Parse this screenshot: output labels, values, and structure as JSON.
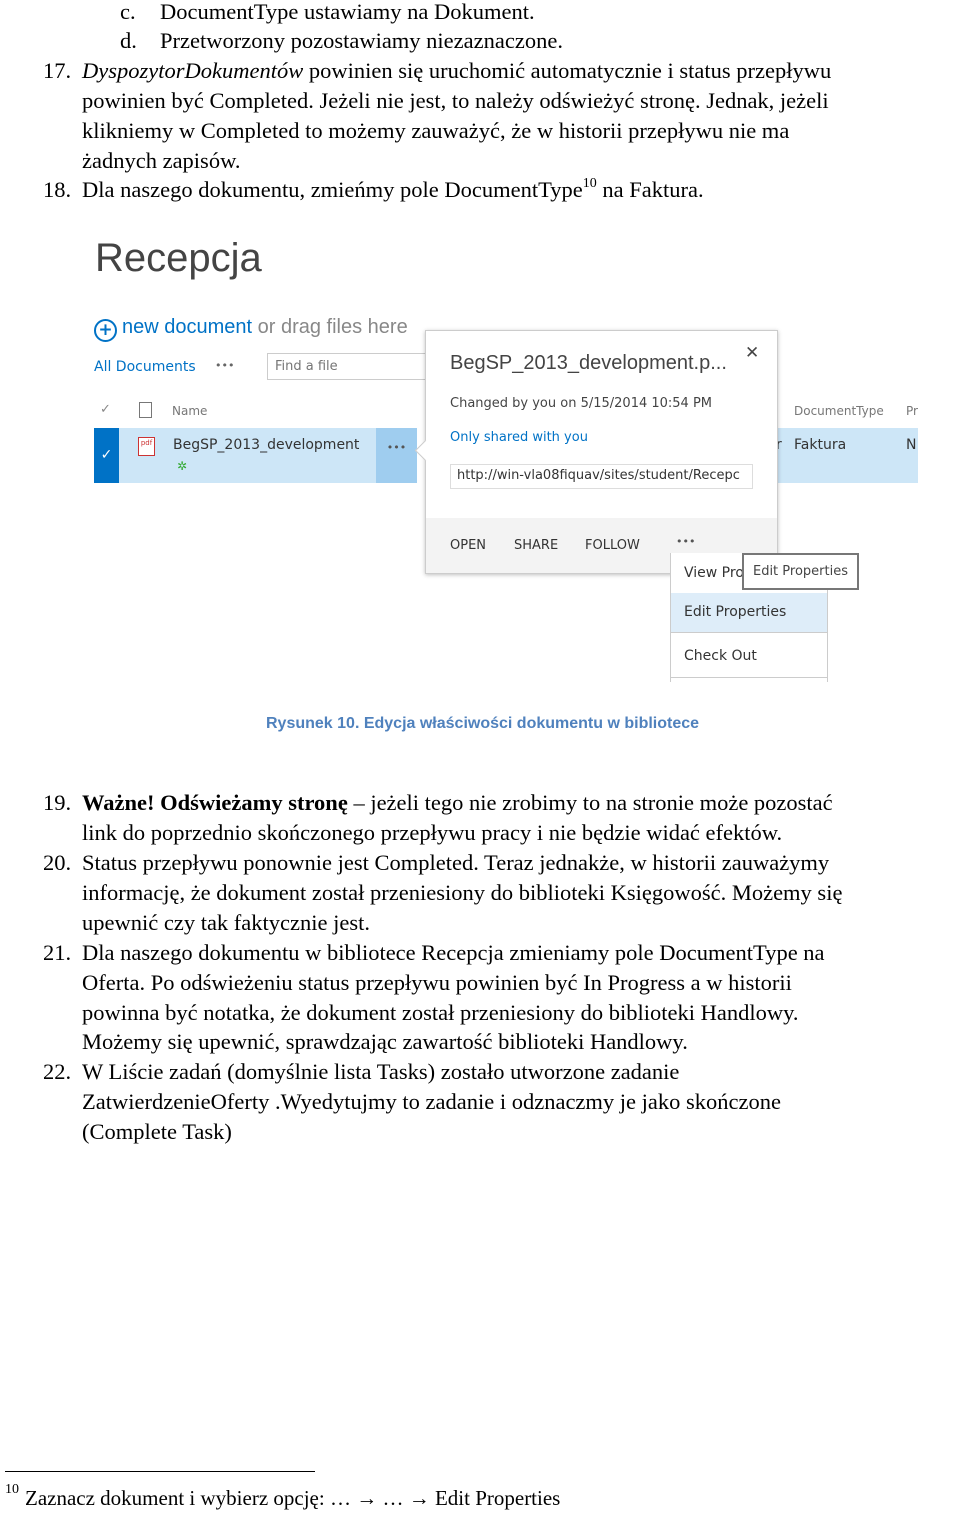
{
  "intro": {
    "items": [
      {
        "marker": "c.",
        "lines": [
          "DocumentType ustawiamy na Dokument."
        ]
      },
      {
        "marker": "d.",
        "lines": [
          "Przetworzony pozostawiamy niezaznaczone."
        ]
      }
    ]
  },
  "item17": {
    "marker": "17.",
    "italic": "DyspozytorDokumentów",
    "lines": [
      " powinien się uruchomić automatycznie i status przepływu",
      "powinien być Completed. Jeżeli nie jest, to należy odświeżyć stronę. Jednak, jeżeli",
      "klikniemy w Completed to możemy zauważyć, że w historii przepływu nie ma",
      "żadnych zapisów."
    ]
  },
  "item18": {
    "marker": "18.",
    "text_before": "Dla naszego dokumentu, zmieńmy pole DocumentType",
    "footnote_ref": "10",
    "text_after": " na Faktura."
  },
  "screenshot": {
    "library_title": "Recepcja",
    "new_document": "new document",
    "drag_text": " or drag files here",
    "view_name": "All Documents",
    "view_more": "•••",
    "search_placeholder": "Find a file",
    "col_name": "Name",
    "col_doctype": "DocumentType",
    "col_pr": "Pr",
    "row": {
      "name": "BegSP_2013_development",
      "ellipsis": "•••",
      "partial": "r",
      "doctype": "Faktura",
      "pr": "N"
    },
    "callout": {
      "title": "BegSP_2013_development.p...",
      "close": "✕",
      "changed": "Changed by you on 5/15/2014 10:54 PM",
      "shared": "Only shared with you",
      "url": "http://win-vla08fiquav/sites/student/Recepc",
      "actions": [
        "OPEN",
        "SHARE",
        "FOLLOW",
        "•••"
      ]
    },
    "menu": {
      "items": [
        "View Pro",
        "Edit Properties",
        "Check Out"
      ],
      "tooltip": "Edit Properties"
    },
    "colors": {
      "accent": "#0072c6",
      "selected_row": "#cde6f7",
      "menu_highlight": "#deedf9"
    }
  },
  "caption": "Rysunek 10. Edycja właściwości dokumentu w bibliotece",
  "item19": {
    "marker": "19.",
    "bold": "Ważne! Odświeżamy stronę",
    "lines": [
      " – jeżeli tego nie zrobimy to na stronie może pozostać",
      "link do poprzednio skończonego przepływu pracy i nie będzie widać efektów."
    ]
  },
  "item20": {
    "marker": "20.",
    "lines": [
      "Status przepływu ponownie jest Completed. Teraz jednakże, w historii zauważymy",
      "informację, że dokument został przeniesiony do biblioteki Księgowość. Możemy się",
      "upewnić czy tak faktycznie jest."
    ]
  },
  "item21": {
    "marker": "21.",
    "lines": [
      "Dla naszego dokumentu w bibliotece Recepcja zmieniamy pole DocumentType na",
      "Oferta. Po odświeżeniu status przepływu powinien być In Progress a w historii",
      "powinna być notatka, że dokument został przeniesiony do biblioteki Handlowy.",
      "Możemy się upewnić, sprawdzając zawartość biblioteki Handlowy."
    ]
  },
  "item22": {
    "marker": "22.",
    "lines": [
      "W Liście zadań (domyślnie lista Tasks) zostało utworzone zadanie",
      "ZatwierdzenieOferty .Wyedytujmy to zadanie i odznaczmy je jako skończone",
      "(Complete Task)"
    ]
  },
  "footnote": {
    "marker": "10",
    "text": "Zaznacz dokument i wybierz opcję: … → … → Edit Properties"
  }
}
